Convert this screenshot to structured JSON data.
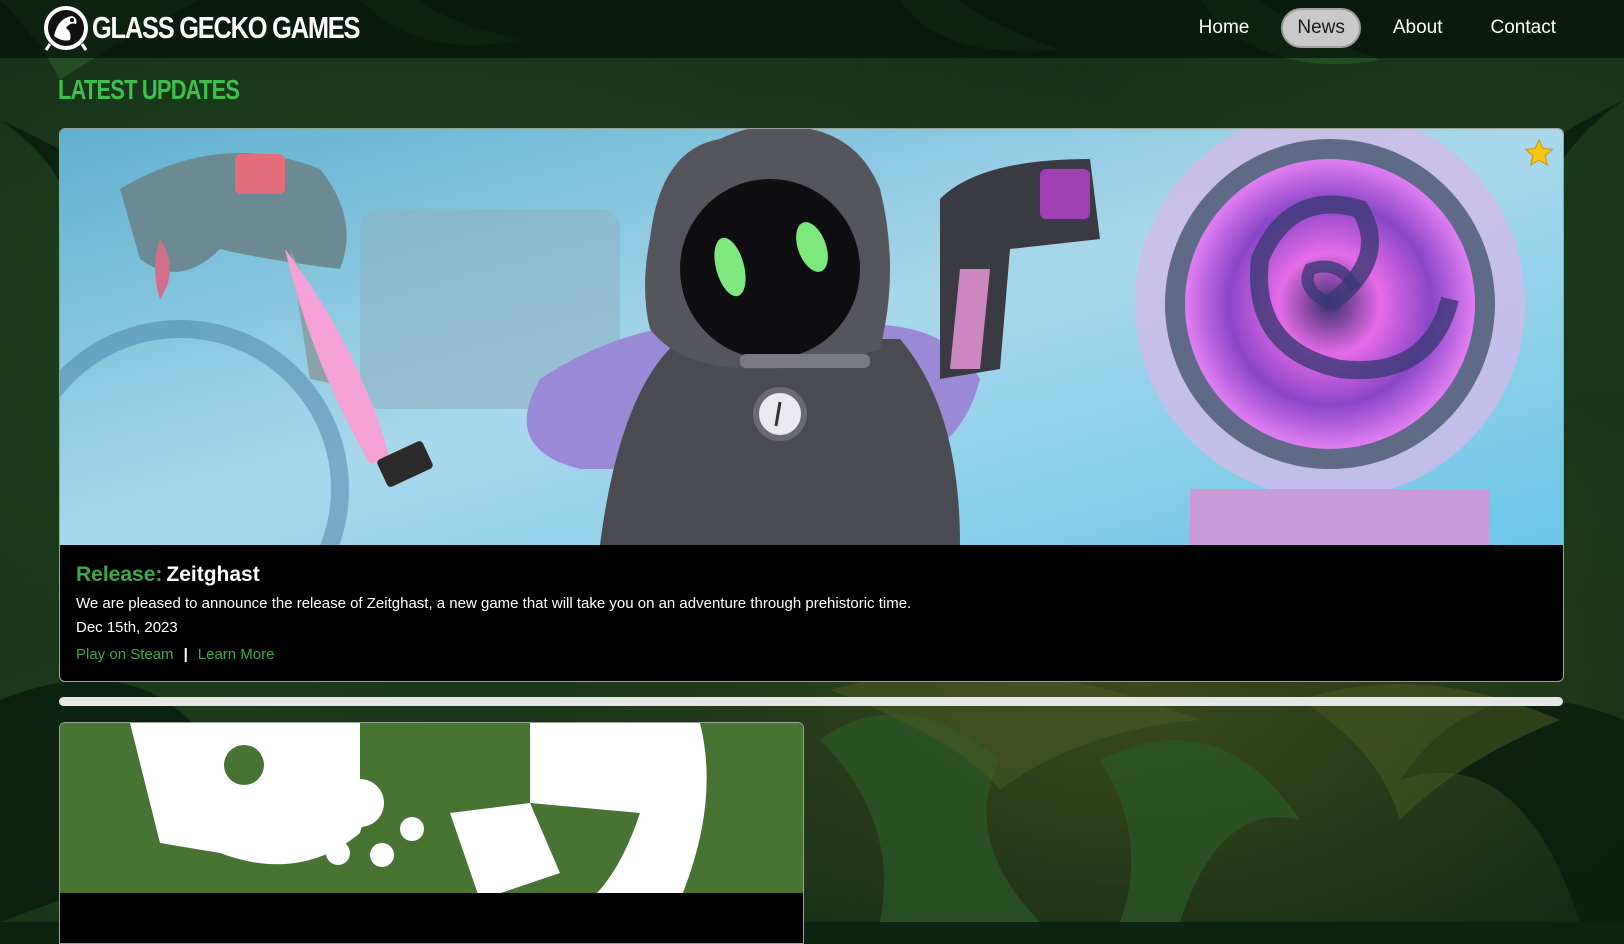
{
  "brand": {
    "name": "GLASS GECKO GAMES",
    "logo_icon": "gecko-logo-icon"
  },
  "nav": {
    "items": [
      {
        "label": "Home",
        "active": false
      },
      {
        "label": "News",
        "active": true
      },
      {
        "label": "About",
        "active": false
      },
      {
        "label": "Contact",
        "active": false
      }
    ]
  },
  "section": {
    "title": "LATEST UPDATES"
  },
  "posts": [
    {
      "kind": "Release:",
      "name": "Zeitghast",
      "description": "We are pleased to announce the release of Zeitghast, a new game that will take you on an adventure through prehistoric time.",
      "date": "Dec 15th, 2023",
      "links": [
        "Play on Steam",
        "Learn More"
      ],
      "separator": "|",
      "featured_icon": "star-icon",
      "featured_color": "#f5c518"
    },
    {
      "image_icon": "gecko-foot-icon",
      "image_bg": "#477333"
    }
  ],
  "colors": {
    "accent_green": "#3fa84a",
    "title_green": "#3fbf4b",
    "active_nav_bg": "#c9c9c9"
  }
}
